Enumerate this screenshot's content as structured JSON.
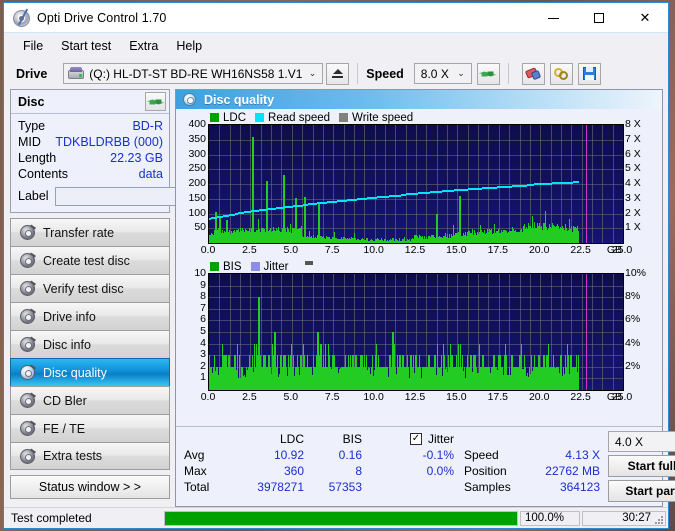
{
  "window": {
    "title": "Opti Drive Control 1.70",
    "icon": "disc-icon",
    "minimize": "–",
    "maximize": "□",
    "close": "✕"
  },
  "menu": {
    "items": [
      "File",
      "Start test",
      "Extra",
      "Help"
    ]
  },
  "toolbar": {
    "drive_label": "Drive",
    "drive_value": "(Q:)  HL-DT-ST BD-RE  WH16NS58 1.V1",
    "eject_icon": "eject-icon",
    "speed_label": "Speed",
    "speed_value": "8.0 X",
    "refresh_icon": "refresh-icon",
    "erase_icon": "eraser-icon",
    "tools_icon": "tools-icon",
    "save_icon": "save-icon"
  },
  "disc": {
    "header": "Disc",
    "refresh_icon": "refresh-icon",
    "rows": [
      {
        "key": "Type",
        "value": "BD-R"
      },
      {
        "key": "MID",
        "value": "TDKBLDRBB (000)"
      },
      {
        "key": "Length",
        "value": "22.23 GB"
      },
      {
        "key": "Contents",
        "value": "data"
      }
    ],
    "label_key": "Label",
    "label_value": "",
    "label_placeholder": "",
    "disc_icon": "cd-icon"
  },
  "nav": {
    "items": [
      {
        "label": "Transfer rate",
        "icon": "disc-icon",
        "active": false
      },
      {
        "label": "Create test disc",
        "icon": "disc-icon",
        "active": false
      },
      {
        "label": "Verify test disc",
        "icon": "disc-icon",
        "active": false
      },
      {
        "label": "Drive info",
        "icon": "disc-icon",
        "active": false
      },
      {
        "label": "Disc info",
        "icon": "disc-icon",
        "active": false
      },
      {
        "label": "Disc quality",
        "icon": "disc-icon",
        "active": true
      },
      {
        "label": "CD Bler",
        "icon": "disc-icon",
        "active": false
      },
      {
        "label": "FE / TE",
        "icon": "disc-icon",
        "active": false
      },
      {
        "label": "Extra tests",
        "icon": "disc-icon",
        "active": false
      }
    ],
    "status_window": "Status window > >"
  },
  "panel": {
    "title": "Disc quality",
    "icon": "disc-icon"
  },
  "chart_data": [
    {
      "type": "line",
      "name": "ldc-chart",
      "title": "",
      "legend": [
        {
          "label": "LDC",
          "color": "#00a000"
        },
        {
          "label": "Read speed",
          "color": "#00e5f5"
        },
        {
          "label": "Write speed",
          "color": "#808080"
        }
      ],
      "legend_position": "top-left",
      "xlabel": "GB",
      "x_ticks": [
        "0.0",
        "2.5",
        "5.0",
        "7.5",
        "10.0",
        "12.5",
        "15.0",
        "17.5",
        "20.0",
        "22.5",
        "25.0"
      ],
      "xlim": [
        0,
        25
      ],
      "ylabel": "",
      "y_ticks": [
        "400",
        "350",
        "300",
        "250",
        "200",
        "150",
        "100",
        "50"
      ],
      "ylim": [
        0,
        400
      ],
      "y2_ticks": [
        "8 X",
        "7 X",
        "6 X",
        "5 X",
        "4 X",
        "3 X",
        "2 X",
        "1 X"
      ],
      "y2lim": [
        0,
        8
      ],
      "grid": true,
      "series": [
        {
          "name": "LDC",
          "color": "#22cc22",
          "type": "bar",
          "note": "dense noise floor ~30-60 across 0-22.3 GB with tall spikes",
          "spikes": [
            {
              "x": 2.62,
              "y": 360
            },
            {
              "x": 3.45,
              "y": 210
            },
            {
              "x": 4.45,
              "y": 232
            },
            {
              "x": 5.2,
              "y": 152
            },
            {
              "x": 5.75,
              "y": 157
            },
            {
              "x": 6.6,
              "y": 140
            },
            {
              "x": 13.7,
              "y": 100
            },
            {
              "x": 15.1,
              "y": 160
            },
            {
              "x": 0.35,
              "y": 105
            },
            {
              "x": 0.6,
              "y": 90
            },
            {
              "x": 1.05,
              "y": 78
            }
          ],
          "noise_baseline": 40
        },
        {
          "name": "Read speed",
          "color": "#00e5f5",
          "type": "line",
          "note": "CAV ramp, stepped",
          "points": [
            {
              "x": 0.0,
              "y_x": 1.72
            },
            {
              "x": 2.5,
              "y_x": 2.2
            },
            {
              "x": 5.0,
              "y_x": 2.55
            },
            {
              "x": 7.5,
              "y_x": 2.85
            },
            {
              "x": 10.0,
              "y_x": 3.15
            },
            {
              "x": 12.5,
              "y_x": 3.4
            },
            {
              "x": 15.0,
              "y_x": 3.65
            },
            {
              "x": 17.5,
              "y_x": 3.85
            },
            {
              "x": 20.0,
              "y_x": 4.05
            },
            {
              "x": 22.3,
              "y_x": 4.18
            }
          ]
        },
        {
          "name": "cursor",
          "color": "#cc33cc",
          "type": "vline",
          "x": 22.76
        }
      ]
    },
    {
      "type": "bar",
      "name": "bis-chart",
      "title": "",
      "legend": [
        {
          "label": "BIS",
          "color": "#00a000"
        },
        {
          "label": "Jitter",
          "color": "#8c8cf0"
        }
      ],
      "legend_position": "top-left",
      "xlabel": "GB",
      "x_ticks": [
        "0.0",
        "2.5",
        "5.0",
        "7.5",
        "10.0",
        "12.5",
        "15.0",
        "17.5",
        "20.0",
        "22.5",
        "25.0"
      ],
      "xlim": [
        0,
        25
      ],
      "y_ticks": [
        "10",
        "9",
        "8",
        "7",
        "6",
        "5",
        "4",
        "3",
        "2",
        "1"
      ],
      "ylim": [
        0,
        10
      ],
      "y2_ticks": [
        "10%",
        "8%",
        "6%",
        "4%",
        "2%"
      ],
      "y2lim": [
        0,
        10
      ],
      "grid": true,
      "series": [
        {
          "name": "BIS",
          "color": "#22cc22",
          "type": "bar",
          "note": "dense bars mostly 2-3 with scattered 4s across 0-22.3 GB",
          "spikes": [
            {
              "x": 2.95,
              "y": 8
            },
            {
              "x": 3.95,
              "y": 5
            },
            {
              "x": 6.55,
              "y": 5
            },
            {
              "x": 11.05,
              "y": 5
            }
          ],
          "noise_baseline": 3
        },
        {
          "name": "cursor",
          "color": "#cc33cc",
          "type": "vline",
          "x": 22.76
        }
      ]
    }
  ],
  "stats": {
    "headers": {
      "ldc": "LDC",
      "bis": "BIS",
      "jitter": "Jitter"
    },
    "jitter_checked": true,
    "jitter_check_glyph": "✓",
    "rows": [
      {
        "label": "Avg",
        "ldc": "10.92",
        "bis": "0.16",
        "jitter": "-0.1%"
      },
      {
        "label": "Max",
        "ldc": "360",
        "bis": "8",
        "jitter": "0.0%"
      },
      {
        "label": "Total",
        "ldc": "3978271",
        "bis": "57353",
        "jitter": ""
      }
    ],
    "right": [
      {
        "key": "Speed",
        "value": "4.13 X"
      },
      {
        "key": "Position",
        "value": "22762 MB"
      },
      {
        "key": "Samples",
        "value": "364123"
      }
    ],
    "speed_select": "4.0 X",
    "start_full": "Start full",
    "start_part": "Start part"
  },
  "statusbar": {
    "message": "Test completed",
    "progress_percent": 100,
    "percent_text": "100.0%",
    "elapsed": "30:27"
  },
  "colors": {
    "accent": "#2a8ad4",
    "plot_bg": "#11116a",
    "data_green": "#22cc22",
    "read_speed": "#00e5f5",
    "cursor": "#cc33cc",
    "value_blue": "#1a2fd0",
    "progress": "#00a000"
  }
}
